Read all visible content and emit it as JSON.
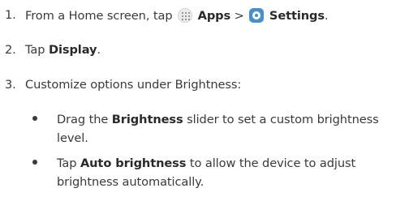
{
  "steps": [
    {
      "number": "1.",
      "prefix": "From a Home screen, tap",
      "apps_label": "Apps",
      "separator": ">",
      "settings_label": "Settings",
      "suffix": "."
    },
    {
      "number": "2.",
      "prefix": "Tap",
      "bold": "Display",
      "suffix": "."
    },
    {
      "number": "3.",
      "text": "Customize options under Brightness:"
    }
  ],
  "bullets": [
    {
      "prefix": "Drag the",
      "bold": "Brightness",
      "suffix": "slider to set a custom brightness level."
    },
    {
      "prefix": "Tap",
      "bold": "Auto brightness",
      "suffix": "to allow the device to adjust brightness automatically."
    }
  ],
  "icons": {
    "apps": "apps-grid-icon",
    "settings": "settings-gear-icon",
    "settings_color": "#4a90c8"
  }
}
